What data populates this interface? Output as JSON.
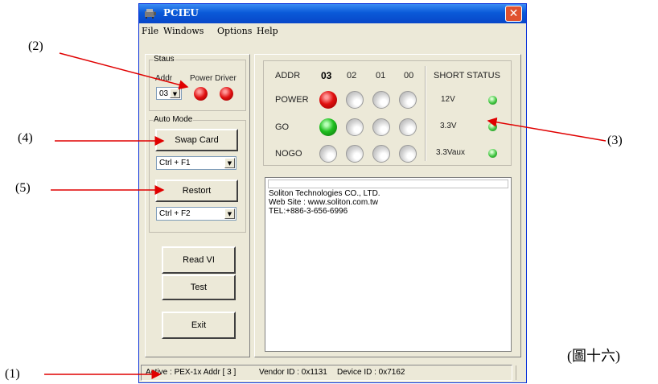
{
  "window": {
    "title": "PCIEU",
    "close_glyph": "✕"
  },
  "menu": {
    "file": "File",
    "windows": "Windows",
    "options": "Options",
    "help": "Help"
  },
  "status_group": {
    "label": "Staus",
    "addr_label": "Addr",
    "power_driver_label": "Power Driver",
    "addr_value": "03"
  },
  "auto_mode": {
    "label": "Auto Mode",
    "swap_card": "Swap Card",
    "swap_hotkey": "Ctrl + F1",
    "restort": "Restort",
    "restort_hotkey": "Ctrl + F2"
  },
  "buttons": {
    "read_vi": "Read  VI",
    "test": "Test",
    "exit": "Exit"
  },
  "indicator_grid": {
    "addr_header": "ADDR",
    "addresses": [
      "03",
      "02",
      "01",
      "00"
    ],
    "rows": [
      {
        "label": "POWER",
        "states": [
          "red",
          "off",
          "off",
          "off"
        ]
      },
      {
        "label": "GO",
        "states": [
          "green",
          "off",
          "off",
          "off"
        ]
      },
      {
        "label": "NOGO",
        "states": [
          "off",
          "off",
          "off",
          "off"
        ]
      }
    ]
  },
  "short_status": {
    "header": "SHORT STATUS",
    "items": [
      "12V",
      "3.3V",
      "3.3Vaux"
    ]
  },
  "log": {
    "lines": [
      "Soliton Technologies CO., LTD.",
      "Web Site : www.soliton.com.tw",
      "TEL:+886-3-656-6996"
    ]
  },
  "statusbar": {
    "active": "Active :  PEX-1x Addr [ 3 ]",
    "vendor": "Vendor ID : 0x1131",
    "device": "Device ID : 0x7162"
  },
  "callouts": {
    "c1": "(1)",
    "c2": "(2)",
    "c3": "(3)",
    "c4": "(4)",
    "c5": "(5)",
    "figure": "(圖十六)"
  },
  "colors": {
    "arrow": "#e00000",
    "led_red": "#e01010",
    "led_green": "#20c020",
    "titlebar": "#0a5ad8"
  }
}
